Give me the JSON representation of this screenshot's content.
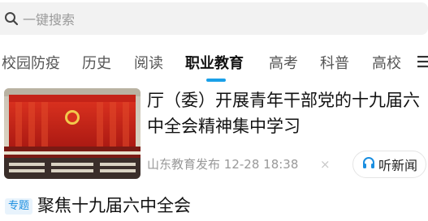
{
  "search": {
    "placeholder": "一键搜索",
    "icon": "search-icon"
  },
  "tabs": [
    {
      "label": "校园防疫",
      "active": false
    },
    {
      "label": "历史",
      "active": false
    },
    {
      "label": "阅读",
      "active": false
    },
    {
      "label": "职业教育",
      "active": true
    },
    {
      "label": "高考",
      "active": false
    },
    {
      "label": "科普",
      "active": false
    },
    {
      "label": "高校",
      "active": false
    }
  ],
  "accent_color": "#1aa0e8",
  "article": {
    "headline": "厅（委）开展青年干部党的十九届六中全会精神集中学习",
    "source": "山东教育发布",
    "time": "12-28 18:38",
    "dismiss_symbol": "×",
    "listen_label": "听新闻",
    "listen_icon": "headphones-icon"
  },
  "topic": {
    "badge": "专题",
    "title": "聚焦十九届六中全会"
  }
}
